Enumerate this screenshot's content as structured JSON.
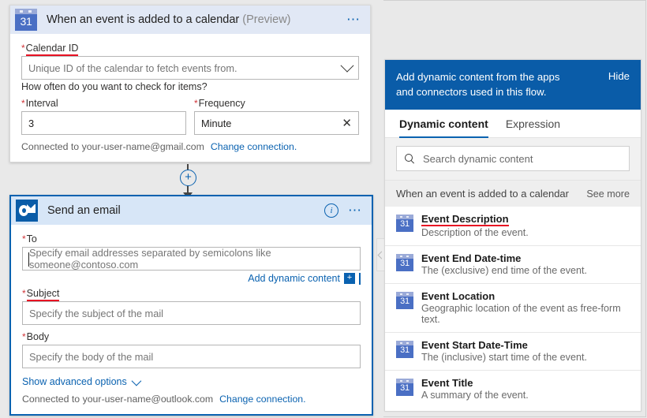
{
  "trigger_card": {
    "icon": "calendar-31-icon",
    "title": "When an event is added to a calendar",
    "preview_tag": "(Preview)",
    "more_icon": "ellipsis-icon",
    "calendar_id": {
      "label": "Calendar ID",
      "required_marker": "*",
      "placeholder": "Unique ID of the calendar to fetch events from.",
      "dropdown_icon": "chevron-down-icon"
    },
    "frequency_question": "How often do you want to check for items?",
    "interval": {
      "label": "Interval",
      "required_marker": "*",
      "value": "3"
    },
    "frequency": {
      "label": "Frequency",
      "required_marker": "*",
      "value": "Minute",
      "clear_icon": "close-x-icon"
    },
    "connection_text": "Connected to your-user-name@gmail.com",
    "change_connection_link": "Change connection."
  },
  "connector": {
    "add_step_icon": "plus-circle-icon",
    "arrow_icon": "arrow-down-icon"
  },
  "action_card": {
    "icon": "outlook-icon",
    "title": "Send an email",
    "info_icon": "info-circle-icon",
    "more_icon": "ellipsis-icon",
    "to": {
      "label": "To",
      "required_marker": "*",
      "placeholder": "Specify email addresses separated by semicolons like someone@contoso.com"
    },
    "add_dynamic_content": {
      "label": "Add dynamic content",
      "icon": "plus-square-icon"
    },
    "subject": {
      "label": "Subject",
      "required_marker": "*",
      "placeholder": "Specify the subject of the mail"
    },
    "body": {
      "label": "Body",
      "required_marker": "*",
      "placeholder": "Specify the body of the mail"
    },
    "show_advanced": {
      "label": "Show advanced options",
      "icon": "chevron-down-icon"
    },
    "connection_text": "Connected to your-user-name@outlook.com",
    "change_connection_link": "Change connection."
  },
  "collapse_handle_icon": "chevron-left-icon",
  "dynamic_panel": {
    "header_text": "Add dynamic content from the apps and connectors used in this flow.",
    "hide_label": "Hide",
    "tabs": [
      {
        "label": "Dynamic content",
        "active": true
      },
      {
        "label": "Expression",
        "active": false
      }
    ],
    "search": {
      "placeholder": "Search dynamic content",
      "icon": "search-icon"
    },
    "group": {
      "title": "When an event is added to a calendar",
      "see_more_label": "See more"
    },
    "items": [
      {
        "icon": "calendar-31-icon",
        "title": "Event Description",
        "description": "Description of the event.",
        "highlighted": true
      },
      {
        "icon": "calendar-31-icon",
        "title": "Event End Date-time",
        "description": "The (exclusive) end time of the event.",
        "highlighted": false
      },
      {
        "icon": "calendar-31-icon",
        "title": "Event Location",
        "description": "Geographic location of the event as free-form text.",
        "highlighted": false
      },
      {
        "icon": "calendar-31-icon",
        "title": "Event Start Date-Time",
        "description": "The (inclusive) start time of the event.",
        "highlighted": false
      },
      {
        "icon": "calendar-31-icon",
        "title": "Event Title",
        "description": "A summary of the event.",
        "highlighted": false
      }
    ]
  },
  "colors": {
    "accent_blue": "#0a62b0",
    "header_blue": "#0a5ca8",
    "card_head_bg": "#e1e8f5",
    "selected_head_bg": "#d7e6f7",
    "required_red": "#d13438",
    "highlight_red": "#e81123",
    "canvas_bg": "#e9e9e9"
  },
  "calendar_icon_day": "31"
}
